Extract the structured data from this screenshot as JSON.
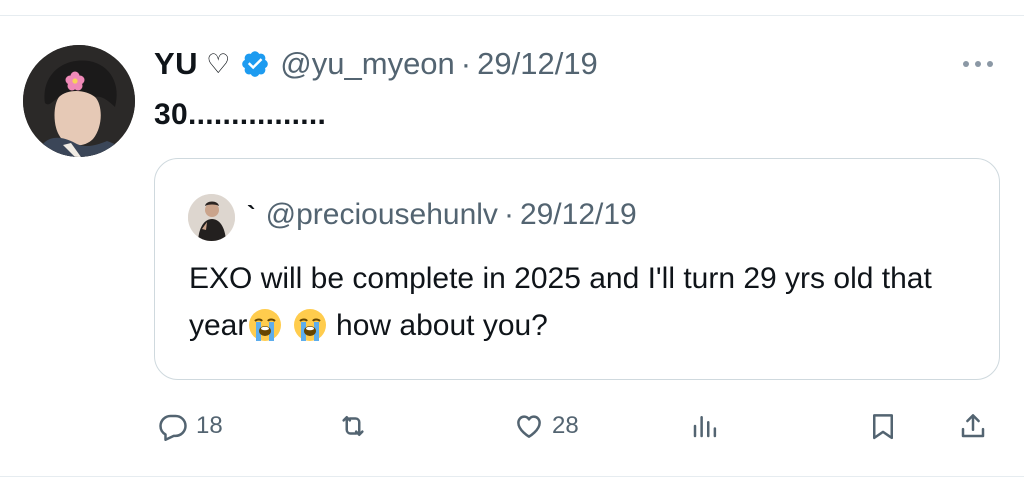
{
  "tweet": {
    "display_name": "YU",
    "name_symbol": "♡",
    "handle": "@yu_myeon",
    "separator": "·",
    "date": "29/12/19",
    "text": "30................",
    "icons": {
      "verified": "verified-badge-icon",
      "more": "more-options-icon"
    }
  },
  "quote": {
    "name": "`",
    "handle": "@preciousehunlv",
    "separator": "·",
    "date": "29/12/19",
    "text_before": "EXO will be complete in 2025 and I'll turn 29 yrs old that year",
    "text_after": " how about you?",
    "emojis": [
      "loudly-crying-face",
      "loudly-crying-face"
    ]
  },
  "actions": {
    "reply_count": "18",
    "retweet_count": "",
    "like_count": "28",
    "icons": [
      "reply-icon",
      "retweet-icon",
      "like-icon",
      "views-icon",
      "bookmark-icon",
      "share-icon"
    ]
  },
  "colors": {
    "text": "#0f1419",
    "secondary": "#536471",
    "verified": "#1d9bf0",
    "border": "#cfd9de"
  }
}
